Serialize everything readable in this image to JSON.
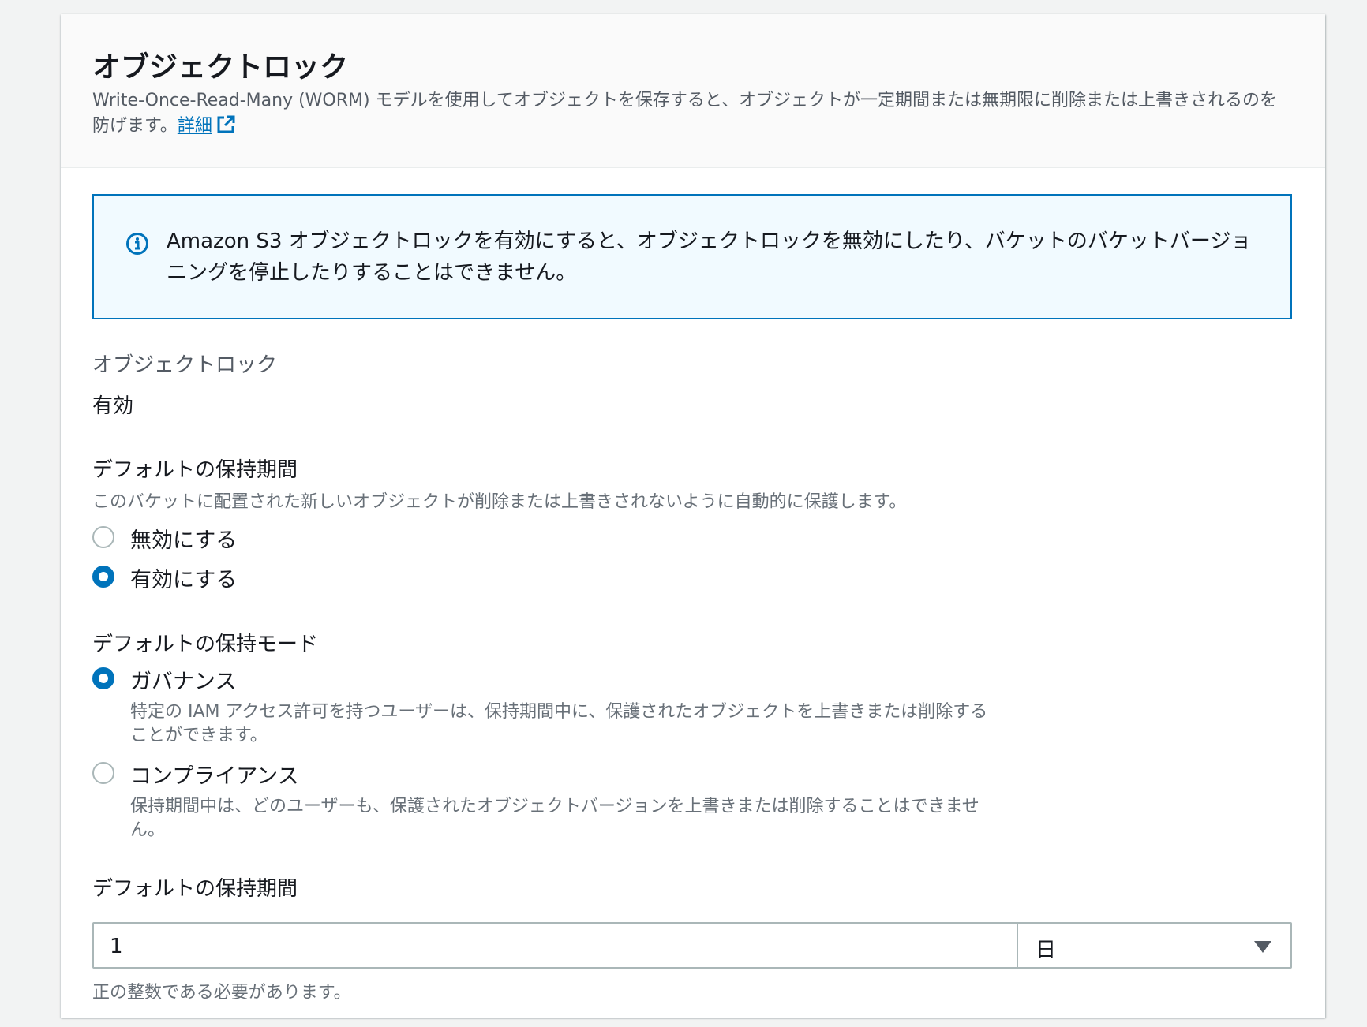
{
  "header": {
    "title": "オブジェクトロック",
    "description": "Write-Once-Read-Many (WORM) モデルを使用してオブジェクトを保存すると、オブジェクトが一定期間または無期限に削除または上書きされるのを防げます。",
    "details_link": "詳細"
  },
  "info_alert": {
    "icon": "info-icon",
    "text": "Amazon S3 オブジェクトロックを有効にすると、オブジェクトロックを無効にしたり、バケットのバケットバージョニングを停止したりすることはできません。"
  },
  "object_lock": {
    "label": "オブジェクトロック",
    "value": "有効"
  },
  "default_retention": {
    "label": "デフォルトの保持期間",
    "description": "このバケットに配置された新しいオブジェクトが削除または上書きされないように自動的に保護します。",
    "options": [
      {
        "label": "無効にする",
        "selected": false
      },
      {
        "label": "有効にする",
        "selected": true
      }
    ]
  },
  "retention_mode": {
    "label": "デフォルトの保持モード",
    "options": [
      {
        "label": "ガバナンス",
        "description": "特定の IAM アクセス許可を持つユーザーは、保持期間中に、保護されたオブジェクトを上書きまたは削除することができます。",
        "selected": true
      },
      {
        "label": "コンプライアンス",
        "description": "保持期間中は、どのユーザーも、保護されたオブジェクトバージョンを上書きまたは削除することはできません。",
        "selected": false
      }
    ]
  },
  "retention_period": {
    "label": "デフォルトの保持期間",
    "value": "1",
    "unit": "日",
    "hint": "正の整数である必要があります。"
  },
  "colors": {
    "accent": "#0073bb",
    "info_bg": "#f1faff"
  }
}
